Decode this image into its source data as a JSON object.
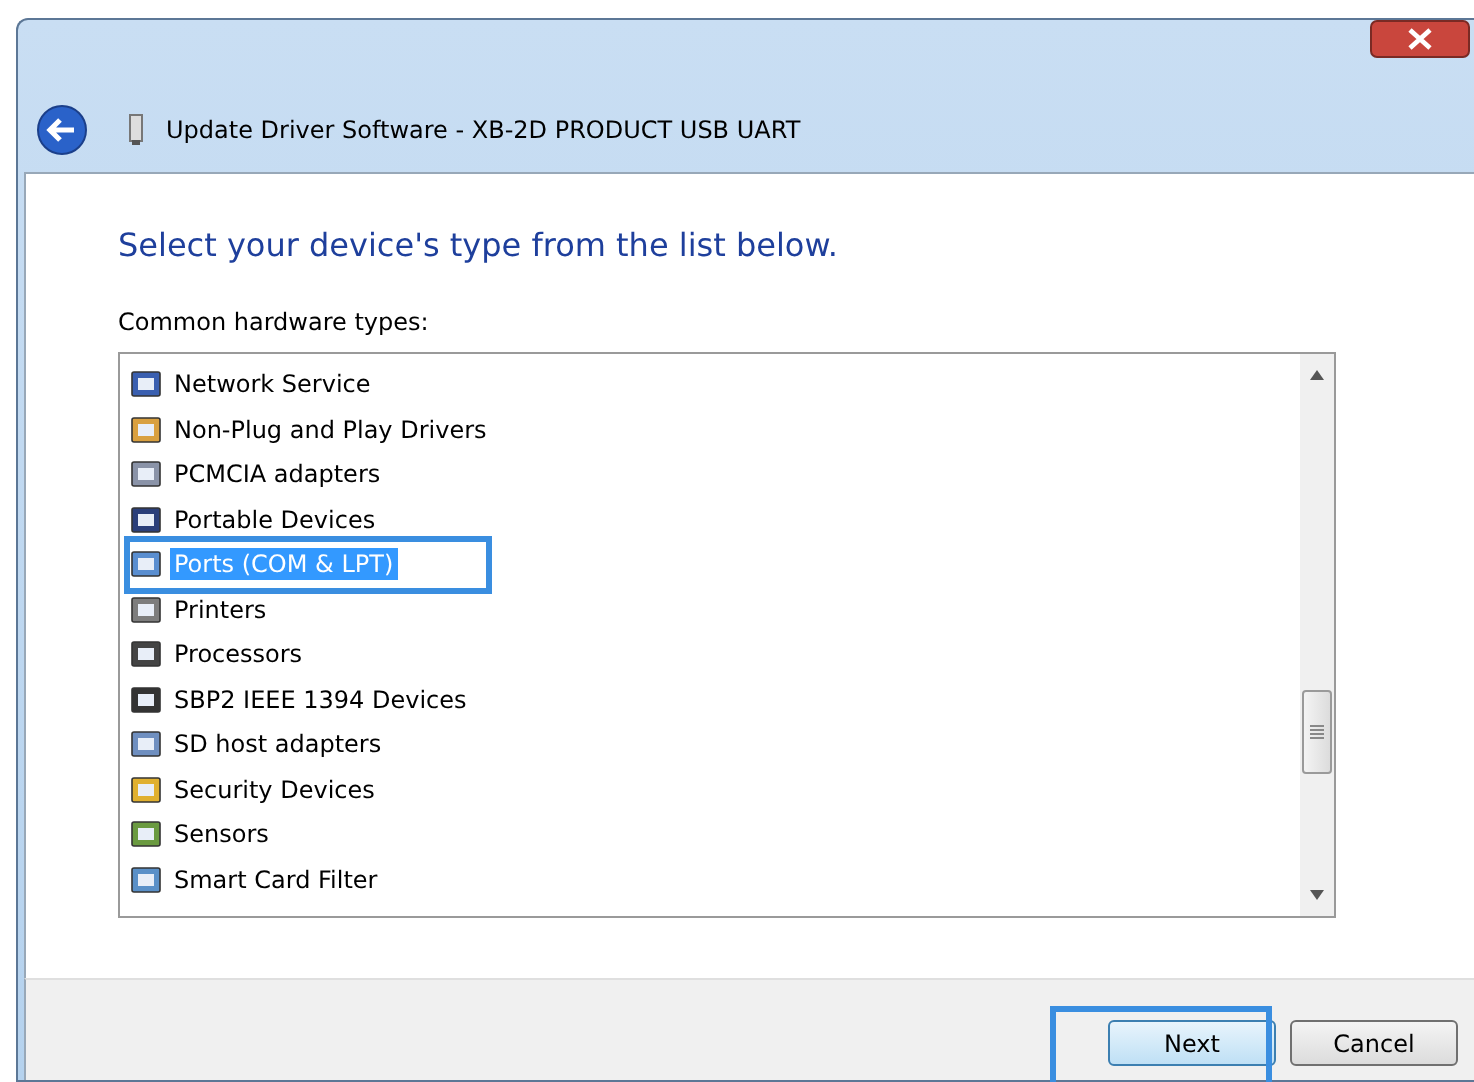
{
  "window": {
    "title": "Update Driver Software - XB-2D PRODUCT USB UART"
  },
  "heading": "Select your device's type from the list below.",
  "list_label": "Common hardware types:",
  "items": [
    {
      "label": "Network Service",
      "selected": false,
      "highlighted": false
    },
    {
      "label": "Non-Plug and Play Drivers",
      "selected": false,
      "highlighted": false
    },
    {
      "label": "PCMCIA adapters",
      "selected": false,
      "highlighted": false
    },
    {
      "label": "Portable Devices",
      "selected": false,
      "highlighted": false
    },
    {
      "label": "Ports (COM & LPT)",
      "selected": true,
      "highlighted": true
    },
    {
      "label": "Printers",
      "selected": false,
      "highlighted": false
    },
    {
      "label": "Processors",
      "selected": false,
      "highlighted": false
    },
    {
      "label": "SBP2 IEEE 1394 Devices",
      "selected": false,
      "highlighted": false
    },
    {
      "label": "SD host adapters",
      "selected": false,
      "highlighted": false
    },
    {
      "label": "Security Devices",
      "selected": false,
      "highlighted": false
    },
    {
      "label": "Sensors",
      "selected": false,
      "highlighted": false
    },
    {
      "label": "Smart Card Filter",
      "selected": false,
      "highlighted": false
    }
  ],
  "buttons": [
    {
      "label": "Next",
      "kind": "default",
      "highlighted": true
    },
    {
      "label": "Cancel",
      "kind": "normal",
      "highlighted": false
    }
  ]
}
